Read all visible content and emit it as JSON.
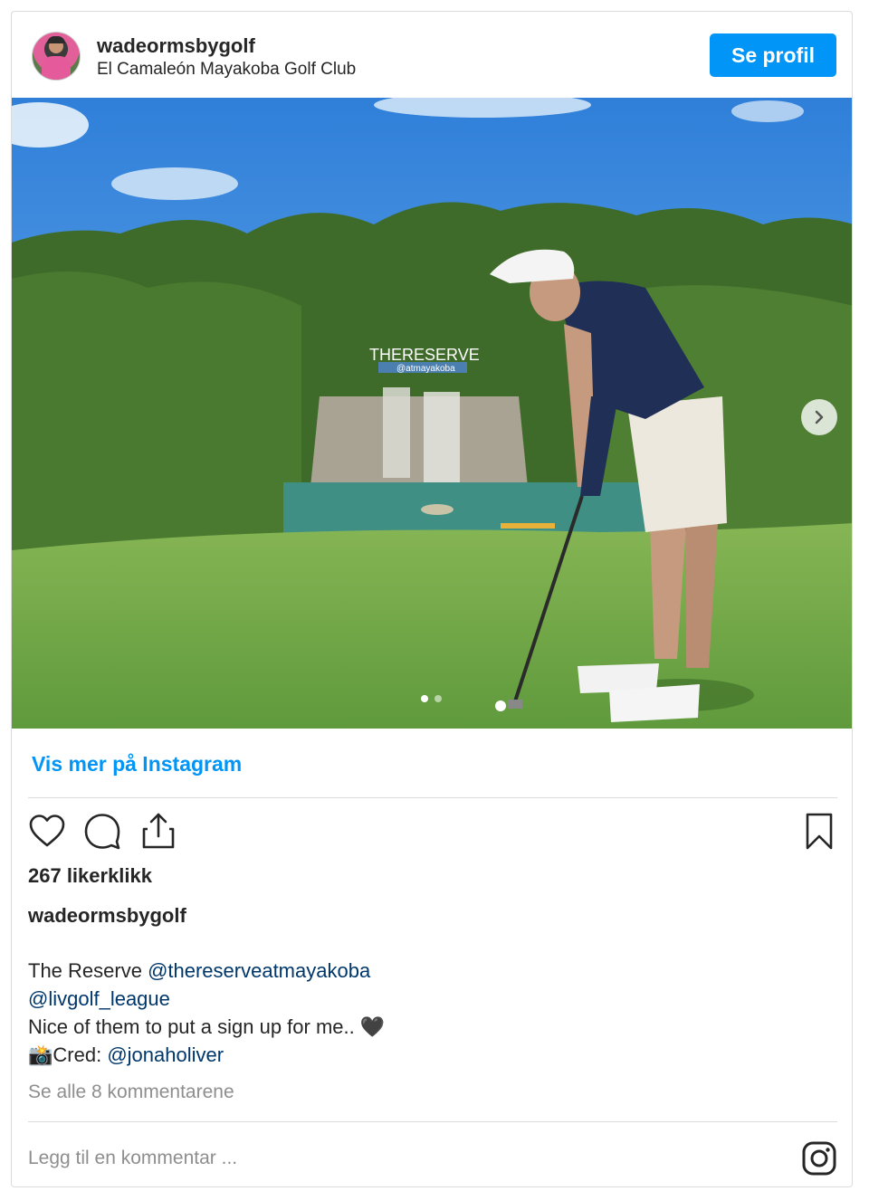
{
  "header": {
    "username": "wadeormsbygolf",
    "location": "El Camaleón Mayakoba Golf Club",
    "profile_button": "Se profil"
  },
  "photo": {
    "sign_text": "THERESERVE",
    "sign_subtext": "@atmayakoba",
    "carousel_pages": 2,
    "carousel_active_index": 0
  },
  "actions": {
    "view_more_link": "Vis mer på Instagram",
    "like_icon": "heart-icon",
    "comment_icon": "comment-icon",
    "share_icon": "share-icon",
    "save_icon": "bookmark-icon"
  },
  "post": {
    "likes": "267 likerklikk",
    "caption_username": "wadeormsbygolf",
    "caption_line1_text": "The Reserve ",
    "caption_line1_mention": "@thereserveatmayakoba",
    "caption_line2_mention": "@livgolf_league",
    "caption_line3": "Nice of them to put a sign up for me.. 🖤",
    "caption_line4_text": "📸Cred: ",
    "caption_line4_mention": "@jonaholiver",
    "view_comments": "Se alle 8 kommentarene"
  },
  "footer": {
    "comment_placeholder": "Legg til en kommentar ...",
    "instagram_icon": "instagram-logo-icon"
  },
  "colors": {
    "accent": "#0095f6",
    "mention": "#00376b",
    "muted": "#8e8e8e",
    "border": "#dbdbdb"
  }
}
